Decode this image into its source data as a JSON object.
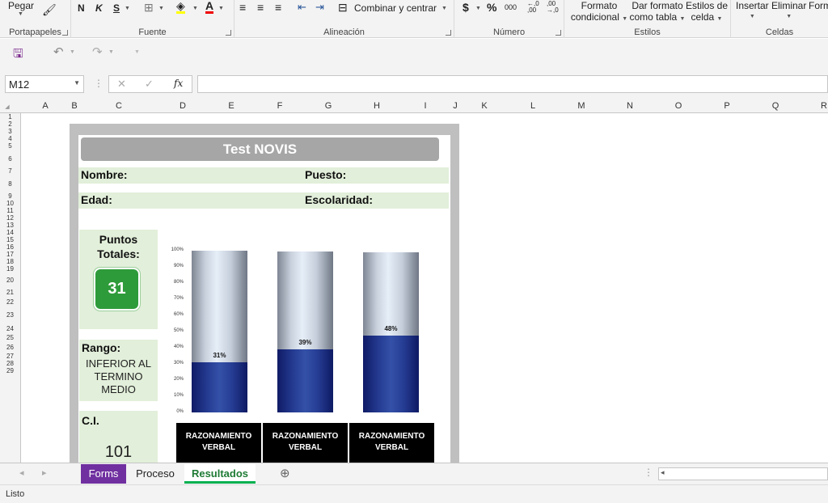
{
  "ribbon": {
    "portapapeles": {
      "paste_label": "Pegar",
      "group_label": "Portapapeles"
    },
    "fuente": {
      "bold": "N",
      "italic": "K",
      "underline": "S",
      "font_color_letter": "A",
      "group_label": "Fuente"
    },
    "alineacion": {
      "merge_label": "Combinar y centrar",
      "group_label": "Alineación"
    },
    "numero": {
      "currency": "$",
      "percent": "%",
      "thousands": "000",
      "dec_up": "←,0\n,00",
      "dec_down": ",00\n→,0",
      "group_label": "Número"
    },
    "estilos": {
      "cond_format_line1": "Formato",
      "cond_format_line2": "condicional",
      "table_format_line1": "Dar formato",
      "table_format_line2": "como tabla",
      "cell_styles_line1": "Estilos de",
      "cell_styles_line2": "celda",
      "group_label": "Estilos"
    },
    "celdas": {
      "insert": "Insertar",
      "delete": "Eliminar",
      "format": "Form",
      "group_label": "Celdas"
    }
  },
  "formula_bar": {
    "name_box": "M12",
    "cancel": "✕",
    "enter": "✓",
    "fx": "fx",
    "value": ""
  },
  "columns": [
    "A",
    "B",
    "C",
    "D",
    "E",
    "F",
    "G",
    "H",
    "I",
    "J",
    "K",
    "L",
    "M",
    "N",
    "O",
    "P",
    "Q",
    "R"
  ],
  "rows": [
    "1",
    "2",
    "3",
    "4",
    "5",
    "6",
    "7",
    "8",
    "9",
    "10",
    "11",
    "12",
    "13",
    "14",
    "15",
    "16",
    "17",
    "18",
    "19",
    "20",
    "21",
    "22",
    "23",
    "24",
    "25",
    "26",
    "27",
    "28",
    "29"
  ],
  "report": {
    "title": "Test NOVIS",
    "nombre_label": "Nombre:",
    "puesto_label": "Puesto:",
    "edad_label": "Edad:",
    "escolaridad_label": "Escolaridad:",
    "puntos_label_1": "Puntos",
    "puntos_label_2": "Totales:",
    "puntos_value": "31",
    "rango_label": "Rango:",
    "rango_line1": "INFERIOR AL",
    "rango_line2": "TERMINO",
    "rango_line3": "MEDIO",
    "ci_label": "C.I.",
    "ci_value": "101"
  },
  "chart_data": {
    "type": "bar",
    "categories": [
      "RAZONAMIENTO VERBAL",
      "RAZONAMIENTO VERBAL",
      "RAZONAMIENTO VERBAL"
    ],
    "values": [
      31,
      39,
      48
    ],
    "value_labels": [
      "31%",
      "39%",
      "48%"
    ],
    "yticks": [
      "100%",
      "90%",
      "80%",
      "70%",
      "60%",
      "50%",
      "40%",
      "30%",
      "20%",
      "10%",
      "0%"
    ],
    "ylim": [
      0,
      100
    ],
    "fill_color": "#263d94",
    "background_color": "#c9d2de"
  },
  "sheet_tabs": [
    {
      "label": "Forms",
      "color": "#7030a0",
      "active": false
    },
    {
      "label": "Proceso",
      "color": "",
      "active": false
    },
    {
      "label": "Resultados",
      "color": "#00b050",
      "active": true
    }
  ],
  "status": {
    "text": "Listo"
  }
}
